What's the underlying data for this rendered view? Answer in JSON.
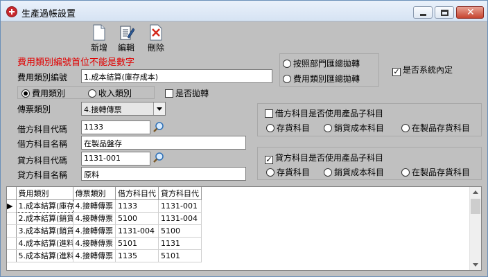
{
  "window": {
    "title": "生產過帳設置",
    "min_glyph": "",
    "close_glyph": "✕"
  },
  "toolbar": {
    "new_label": "新增",
    "edit_label": "編輯",
    "delete_label": "刪除"
  },
  "form": {
    "warning": "費用類別編號首位不能是數字",
    "category_code_label": "費用類別編號",
    "category_code_value": "1.成本結算(庫存成本)",
    "type_radios": [
      {
        "label": "費用類別",
        "selected": true
      },
      {
        "label": "收入類別",
        "selected": false
      }
    ],
    "allocate_label": "是否拋轉",
    "allocate_checked": "",
    "voucher_type_label": "傳票類別",
    "voucher_type_value": "4.接轉傳票",
    "debit_code_label": "借方科目代碼",
    "debit_code_value": "1133",
    "debit_name_label": "借方科目名稱",
    "debit_name_value": "在製品盤存",
    "credit_code_label": "貸方科目代碼",
    "credit_code_value": "1131-001",
    "credit_name_label": "貸方科目名稱",
    "credit_name_value": "原料"
  },
  "summary_mode": {
    "options": [
      {
        "label": "按照部門匯總拋轉",
        "selected": false
      },
      {
        "label": "費用類別匯總拋轉",
        "selected": false
      }
    ]
  },
  "system_default": {
    "label": "是否系統內定",
    "checked": "✓"
  },
  "debit_group": {
    "check_label": "借方科目是否使用產品子科目",
    "checked": "",
    "options": [
      {
        "label": "存貨科目",
        "selected": false
      },
      {
        "label": "銷貨成本科目",
        "selected": false
      },
      {
        "label": "在製品存貨科目",
        "selected": false
      }
    ]
  },
  "credit_group": {
    "check_label": "貸方科目是否使用產品子科目",
    "checked": "✓",
    "options": [
      {
        "label": "存貨科目",
        "selected": false
      },
      {
        "label": "銷貨成本科目",
        "selected": false
      },
      {
        "label": "在製品存貨科目",
        "selected": false
      }
    ]
  },
  "grid": {
    "columns": [
      "費用類別",
      "傳票類別",
      "借方科目代",
      "貸方科目代"
    ],
    "current_row_marker": "▶",
    "rows": [
      [
        "1.成本結算(庫存",
        "4.接轉傳票",
        "1133",
        "1131-001"
      ],
      [
        "2.成本結算(銷貨",
        "4.接轉傳票",
        "5100",
        "1131-004"
      ],
      [
        "3.成本結算(銷貨",
        "4.接轉傳票",
        "1131-004",
        "5100"
      ],
      [
        "4.成本結算(進料",
        "4.接轉傳票",
        "5101",
        "1131"
      ],
      [
        "5.成本結算(進料",
        "4.接轉傳票",
        "1135",
        "5101"
      ]
    ]
  }
}
